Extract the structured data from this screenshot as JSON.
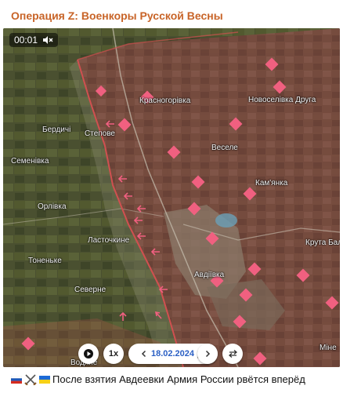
{
  "channel": {
    "title": "Операция Z: Военкоры Русской Весны"
  },
  "video": {
    "timestamp": "00:01",
    "mute_icon": "muted-speaker-icon",
    "places": [
      {
        "id": "krasnohorivka",
        "label": "Красногорівка"
      },
      {
        "id": "novoselivka",
        "label": "Новоселівка Друга"
      },
      {
        "id": "berdychi",
        "label": "Бердичі"
      },
      {
        "id": "stepove",
        "label": "Степове"
      },
      {
        "id": "semenivka",
        "label": "Семенівка"
      },
      {
        "id": "vesele",
        "label": "Веселе"
      },
      {
        "id": "kamianka",
        "label": "Кам'янка"
      },
      {
        "id": "orlivka",
        "label": "Орлівка"
      },
      {
        "id": "lastochkyne",
        "label": "Ласточкине"
      },
      {
        "id": "kruta_balka",
        "label": "Крута Балк"
      },
      {
        "id": "tonenke",
        "label": "Тоненьке"
      },
      {
        "id": "avdiivka",
        "label": "Авдіївка"
      },
      {
        "id": "severne",
        "label": "Северне"
      },
      {
        "id": "vodiane",
        "label": "Водяне"
      },
      {
        "id": "mine",
        "label": "Міне"
      }
    ]
  },
  "controls": {
    "play_icon": "play-icon",
    "speed": "1x",
    "prev_icon": "chevron-left-icon",
    "date": "18.02.2024",
    "calendar_icon": "calendar-icon",
    "next_icon": "chevron-right-icon",
    "swap_icon": "swap-arrows-icon"
  },
  "caption": {
    "text": "После взятия Авдеевки Армия России рвётся вперёд",
    "emojis": [
      "russia-flag-icon",
      "crossed-swords-icon",
      "ukraine-flag-icon"
    ]
  },
  "colors": {
    "channel_title": "#c86428",
    "front_zone": "#c0504d",
    "marker": "#f06080",
    "date_text": "#2a5fc4"
  }
}
